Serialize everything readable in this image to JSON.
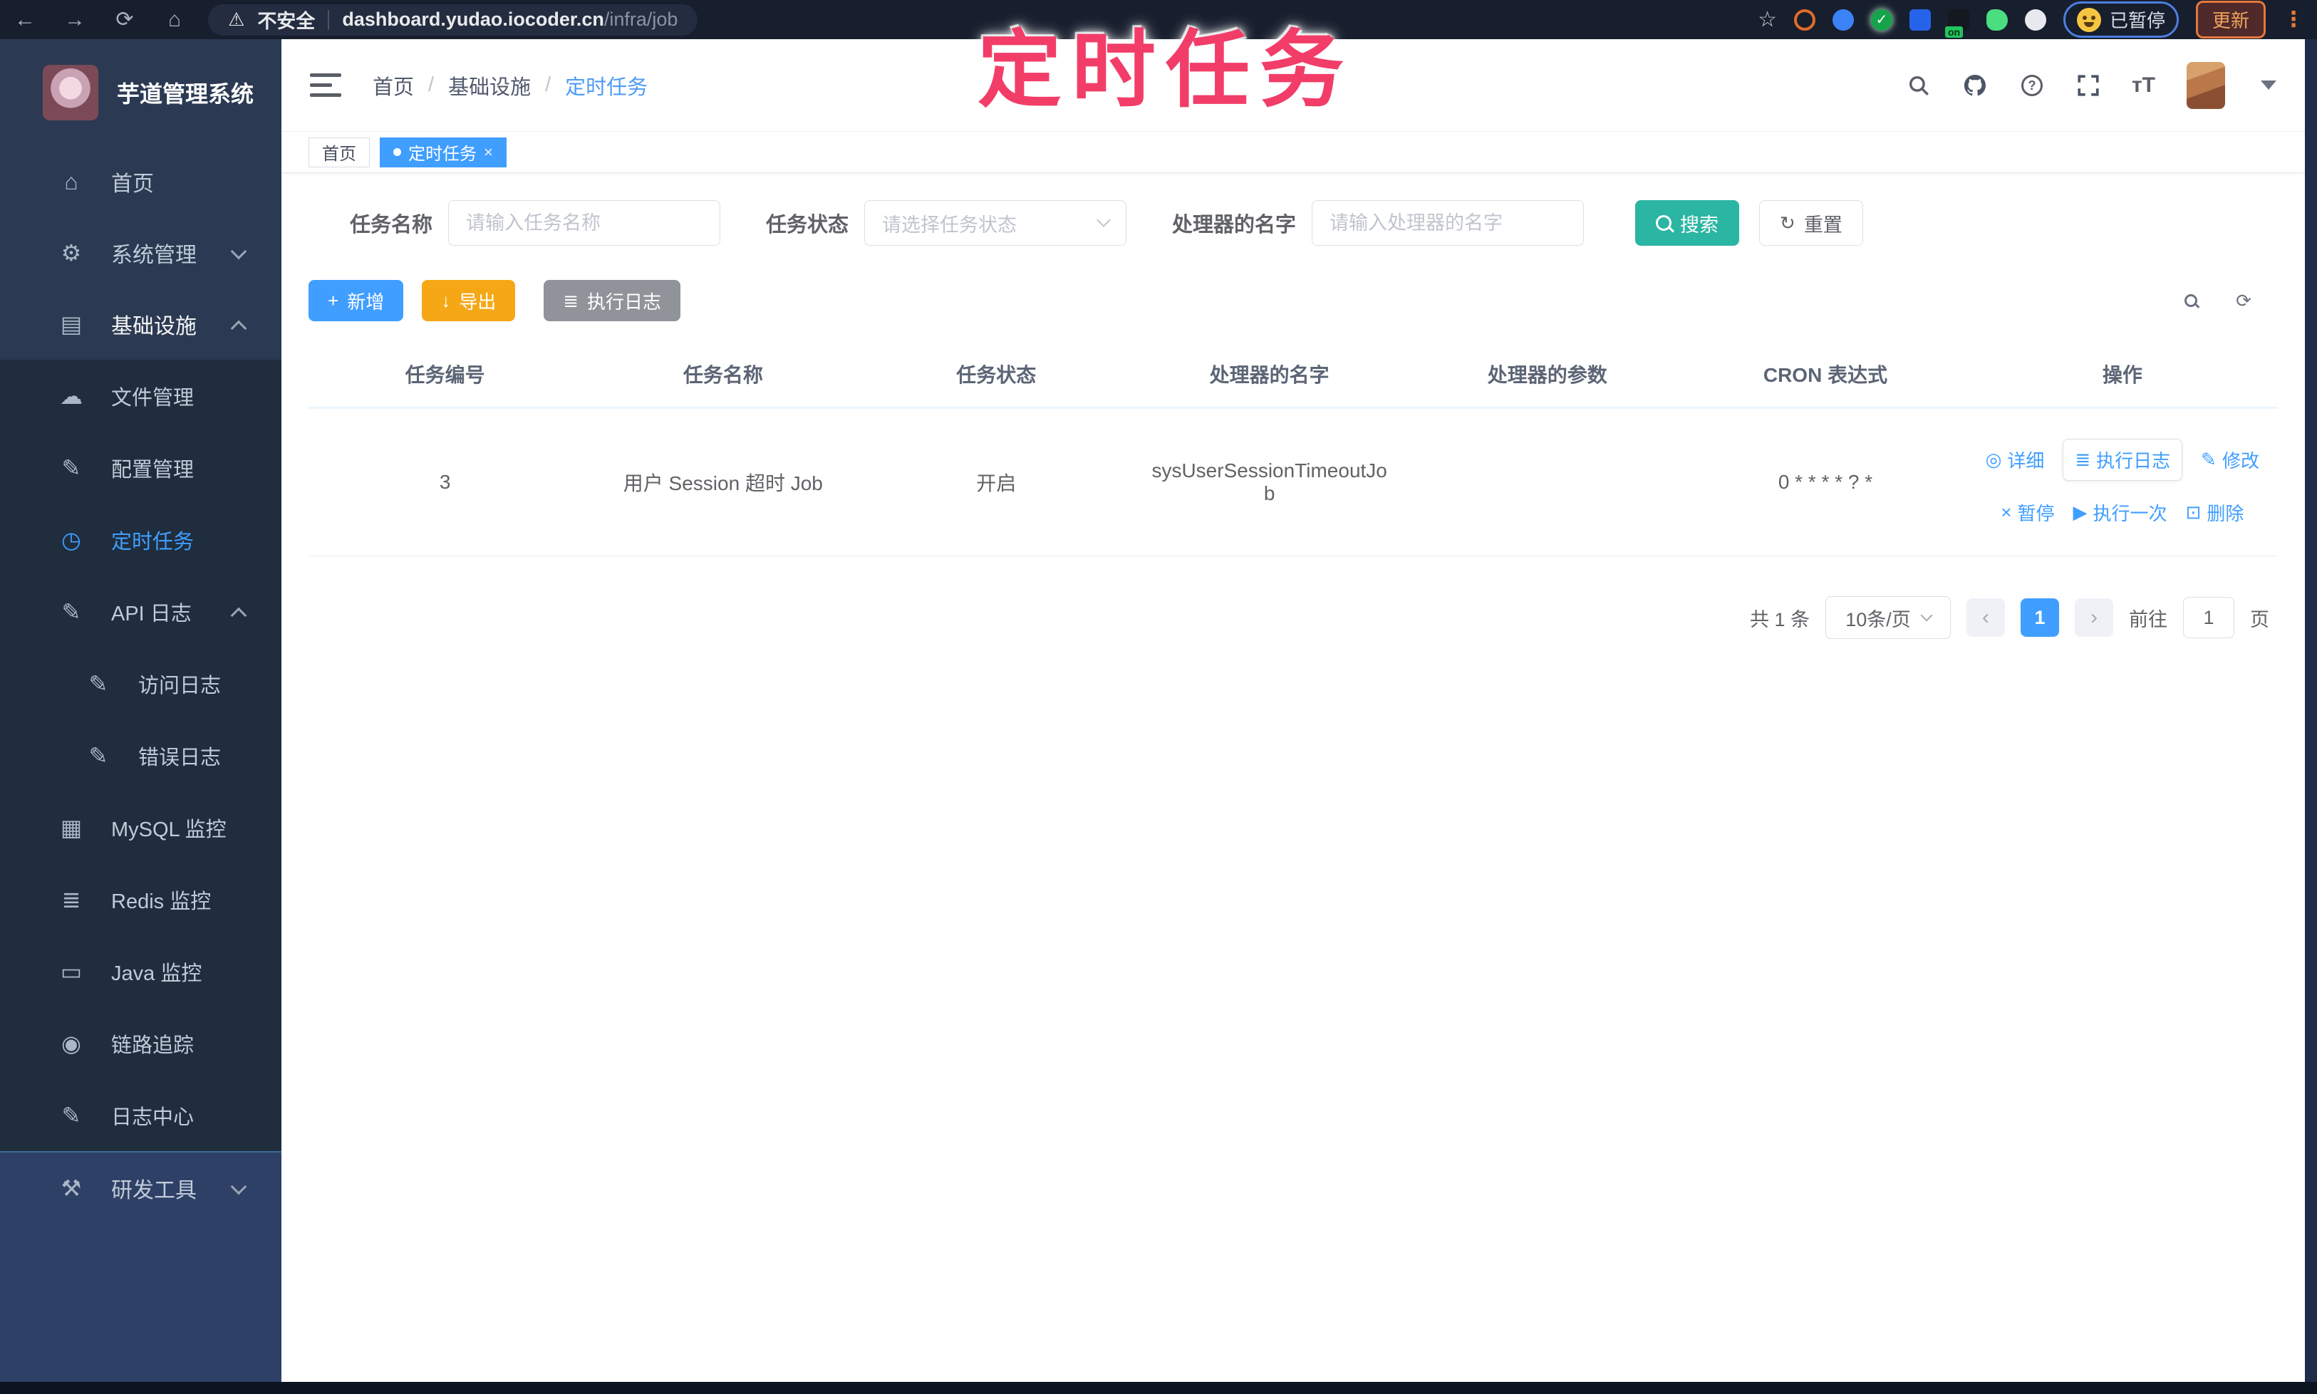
{
  "browser": {
    "security_label": "不安全",
    "url_host": "dashboard.yudao.iocoder.cn",
    "url_path": "/infra/job",
    "paused_badge": "已暂停",
    "update_button": "更新",
    "extension_badge_on": "on"
  },
  "annotation": {
    "text": "定时任务",
    "color": "#f23d68"
  },
  "sidebar": {
    "title": "芋道管理系统",
    "items": [
      {
        "label": "首页",
        "glyph": "⌂"
      },
      {
        "label": "系统管理",
        "glyph": "⚙"
      },
      {
        "label": "基础设施",
        "glyph": "▤"
      },
      {
        "label": "文件管理",
        "glyph": "☁"
      },
      {
        "label": "配置管理",
        "glyph": "✎"
      },
      {
        "label": "定时任务",
        "glyph": "◷"
      },
      {
        "label": "API 日志",
        "glyph": "✎"
      },
      {
        "label": "访问日志",
        "glyph": "✎"
      },
      {
        "label": "错误日志",
        "glyph": "✎"
      },
      {
        "label": "MySQL 监控",
        "glyph": "▦"
      },
      {
        "label": "Redis 监控",
        "glyph": "≣"
      },
      {
        "label": "Java 监控",
        "glyph": "▭"
      },
      {
        "label": "链路追踪",
        "glyph": "◉"
      },
      {
        "label": "日志中心",
        "glyph": "✎"
      },
      {
        "label": "研发工具",
        "glyph": "⚒"
      }
    ]
  },
  "header": {
    "breadcrumb": [
      "首页",
      "基础设施",
      "定时任务"
    ]
  },
  "tabs": {
    "home": "首页",
    "active": "定时任务",
    "close": "×"
  },
  "filters": {
    "name_label": "任务名称",
    "name_placeholder": "请输入任务名称",
    "status_label": "任务状态",
    "status_placeholder": "请选择任务状态",
    "handler_label": "处理器的名字",
    "handler_placeholder": "请输入处理器的名字",
    "search_label": "搜索",
    "reset_label": "重置"
  },
  "toolbar": {
    "add_label": "新增",
    "add_glyph": "+",
    "export_label": "导出",
    "export_glyph": "↓",
    "log_label": "执行日志",
    "log_glyph": "≣",
    "refresh_glyph": "⟳"
  },
  "table": {
    "columns": [
      "任务编号",
      "任务名称",
      "任务状态",
      "处理器的名字",
      "处理器的参数",
      "CRON 表达式",
      "操作"
    ],
    "row": {
      "id": "3",
      "name": "用户 Session 超时 Job",
      "status": "开启",
      "handler": "sysUserSessionTimeoutJob",
      "params": "",
      "cron": "0 * * * * ? *"
    }
  },
  "row_actions": {
    "detail": "详细",
    "detail_glyph": "◎",
    "log": "执行日志",
    "log_glyph": "≣",
    "edit": "修改",
    "edit_glyph": "✎",
    "pause": "暂停",
    "pause_glyph": "×",
    "run_once": "执行一次",
    "run_glyph": "▶",
    "delete": "删除",
    "delete_glyph": "⊡"
  },
  "pagination": {
    "total": "共 1 条",
    "page_size": "10条/页",
    "prev": "‹",
    "page": "1",
    "next": "›",
    "goto_label": "前往",
    "goto_value": "1",
    "unit": "页"
  },
  "colors": {
    "accent": "#409eff",
    "search": "#2bb5a3",
    "export": "#f5a716",
    "gray_button": "#909399",
    "annotation": "#f23d68"
  }
}
